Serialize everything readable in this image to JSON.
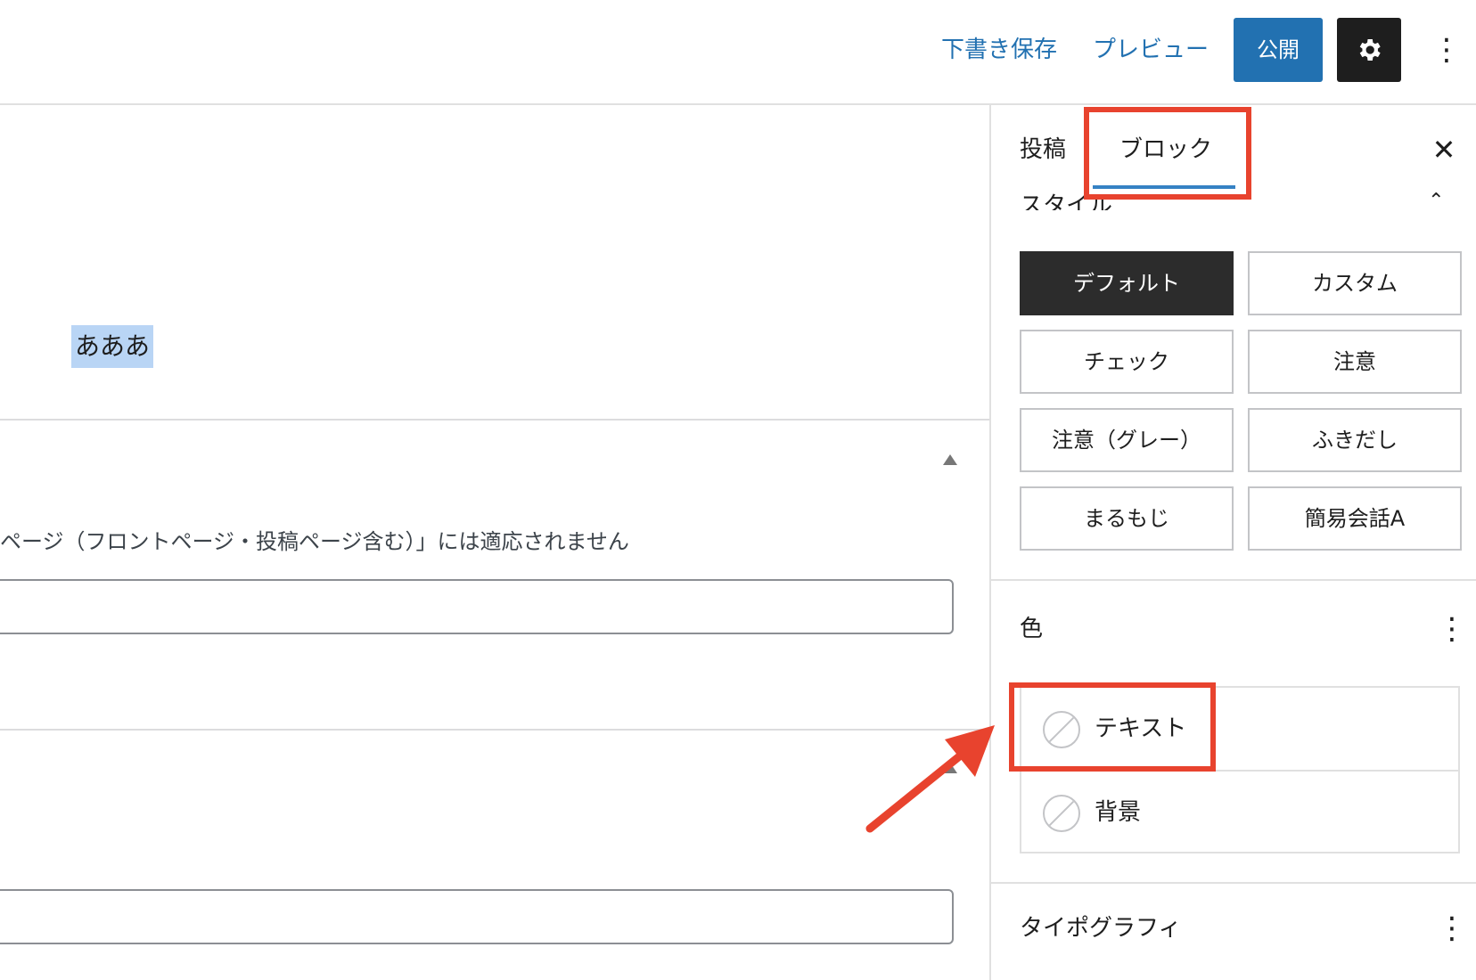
{
  "header": {
    "save_draft": "下書き保存",
    "preview": "プレビュー",
    "publish": "公開",
    "settings_icon": "gear-icon",
    "more_icon": "vertical-ellipsis-icon"
  },
  "editor": {
    "selected_text": "あああ",
    "notice_text": "ページ（フロントページ・投稿ページ含む）」には適応されません",
    "input1_value": "",
    "input2_value": ""
  },
  "sidebar": {
    "tabs": [
      {
        "label": "投稿",
        "active": false
      },
      {
        "label": "ブロック",
        "active": true
      }
    ],
    "style_section": {
      "title": "スタイル",
      "options": [
        {
          "label": "デフォルト",
          "active": true
        },
        {
          "label": "カスタム",
          "active": false
        },
        {
          "label": "チェック",
          "active": false
        },
        {
          "label": "注意",
          "active": false
        },
        {
          "label": "注意（グレー）",
          "active": false
        },
        {
          "label": "ふきだし",
          "active": false
        },
        {
          "label": "まるもじ",
          "active": false
        },
        {
          "label": "簡易会話A",
          "active": false
        }
      ]
    },
    "color_section": {
      "title": "色",
      "items": [
        {
          "label": "テキスト"
        },
        {
          "label": "背景"
        }
      ]
    },
    "typography_section": {
      "title": "タイポグラフィ"
    }
  },
  "colors": {
    "accent": "#2271b1",
    "annotation": "#e8432e",
    "active_style": "#2c2c2c",
    "selection": "#b9d5f5"
  }
}
